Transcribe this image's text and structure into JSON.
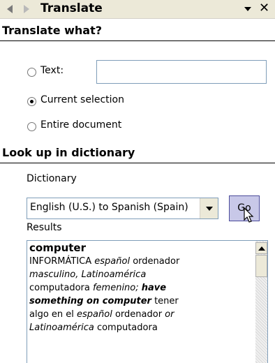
{
  "panel": {
    "title": "Translate"
  },
  "translate_what": {
    "heading": "Translate what?",
    "options": [
      {
        "label": "Text:",
        "checked": false
      },
      {
        "label": "Current selection",
        "checked": true
      },
      {
        "label": "Entire document",
        "checked": false
      }
    ],
    "text_value": ""
  },
  "dictionary": {
    "heading": "Look up in dictionary",
    "label": "Dictionary",
    "selected": "English (U.S.) to Spanish (Spain)",
    "go_label": "Go"
  },
  "results": {
    "label": "Results",
    "headword": "computer",
    "line1_prefix": "INFORMÁTICA ",
    "line1_italic": "español",
    "line1_suffix": " ordenador",
    "line2_italic": "masculino, Latinoamérica",
    "line3_plain": "computadora ",
    "line3_italic": "femenino;",
    "line3_bold": "have",
    "line4_bold": "something on computer",
    "line4_plain": " tener",
    "line5_prefix": "algo en el ",
    "line5_italic": "español",
    "line5_mid": " ordenador ",
    "line5_italic2": "or",
    "line6_italic": "Latinoamérica",
    "line6_plain": " computadora"
  }
}
